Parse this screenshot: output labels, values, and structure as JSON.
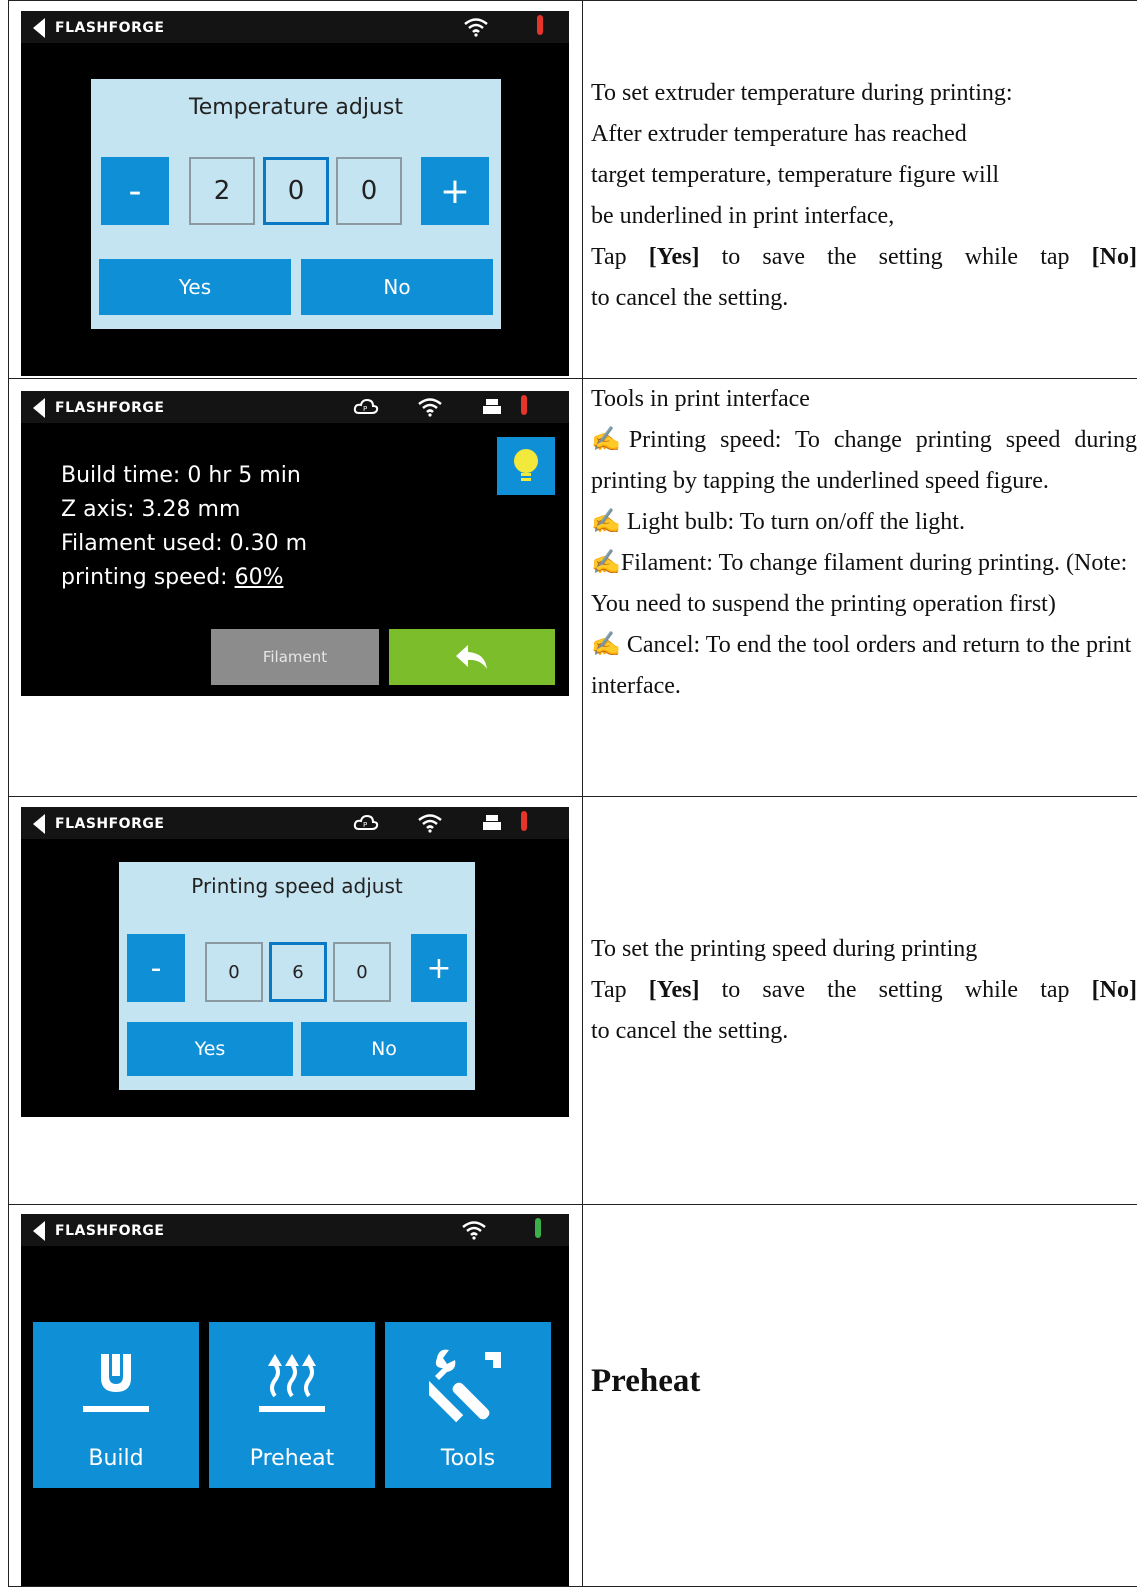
{
  "brand": "FLASHFORGE",
  "colors": {
    "accent_blue": "#0f8fd6",
    "dialog_bg": "#c5e4f1",
    "back_green": "#7cbd2b",
    "thermo_hot": "#e5352b",
    "thermo_ok": "#3ab04a"
  },
  "row1": {
    "dialog_title": "Temperature adjust",
    "minus": "-",
    "plus": "+",
    "digits": [
      "2",
      "0",
      "0"
    ],
    "yes": "Yes",
    "no": "No",
    "desc_line1": "To set extruder temperature during printing:",
    "desc_line2": "After extruder temperature has reached",
    "desc_line3": "target temperature, temperature figure will",
    "desc_line4": "be underlined in print interface,",
    "desc_tap": "Tap",
    "desc_yes": "[Yes]",
    "desc_mid": "to save the setting while tap",
    "desc_no": "[No]",
    "desc_end": "to cancel the setting."
  },
  "row2": {
    "build_time": "Build time: 0 hr 5 min",
    "z_axis": "Z axis: 3.28 mm",
    "filament_used": "Filament used: 0.30 m",
    "speed_label": "printing speed: ",
    "speed_value": "60%",
    "filament_button": "Filament",
    "desc_title": "Tools in print interface",
    "desc_1a": "✍Printing speed: To change printing speed during printing by tapping the underlined speed figure.",
    "desc_2": "✍ Light bulb: To turn on/off the light.",
    "desc_3": "✍Filament: To change filament during printing. (Note: You need to suspend the printing operation first)",
    "desc_4": "✍ Cancel: To end the tool orders and return to the print interface."
  },
  "row3": {
    "dialog_title": "Printing speed adjust",
    "minus": "-",
    "plus": "+",
    "digits": [
      "0",
      "6",
      "0"
    ],
    "yes": "Yes",
    "no": "No",
    "desc_line1": "To set the printing speed during printing",
    "desc_tap": "Tap",
    "desc_yes": "[Yes]",
    "desc_mid": "to save the setting while tap",
    "desc_no": "[No]",
    "desc_end": "to cancel the setting."
  },
  "row4": {
    "tiles": [
      "Build",
      "Preheat",
      "Tools"
    ],
    "desc_heading": "Preheat"
  }
}
